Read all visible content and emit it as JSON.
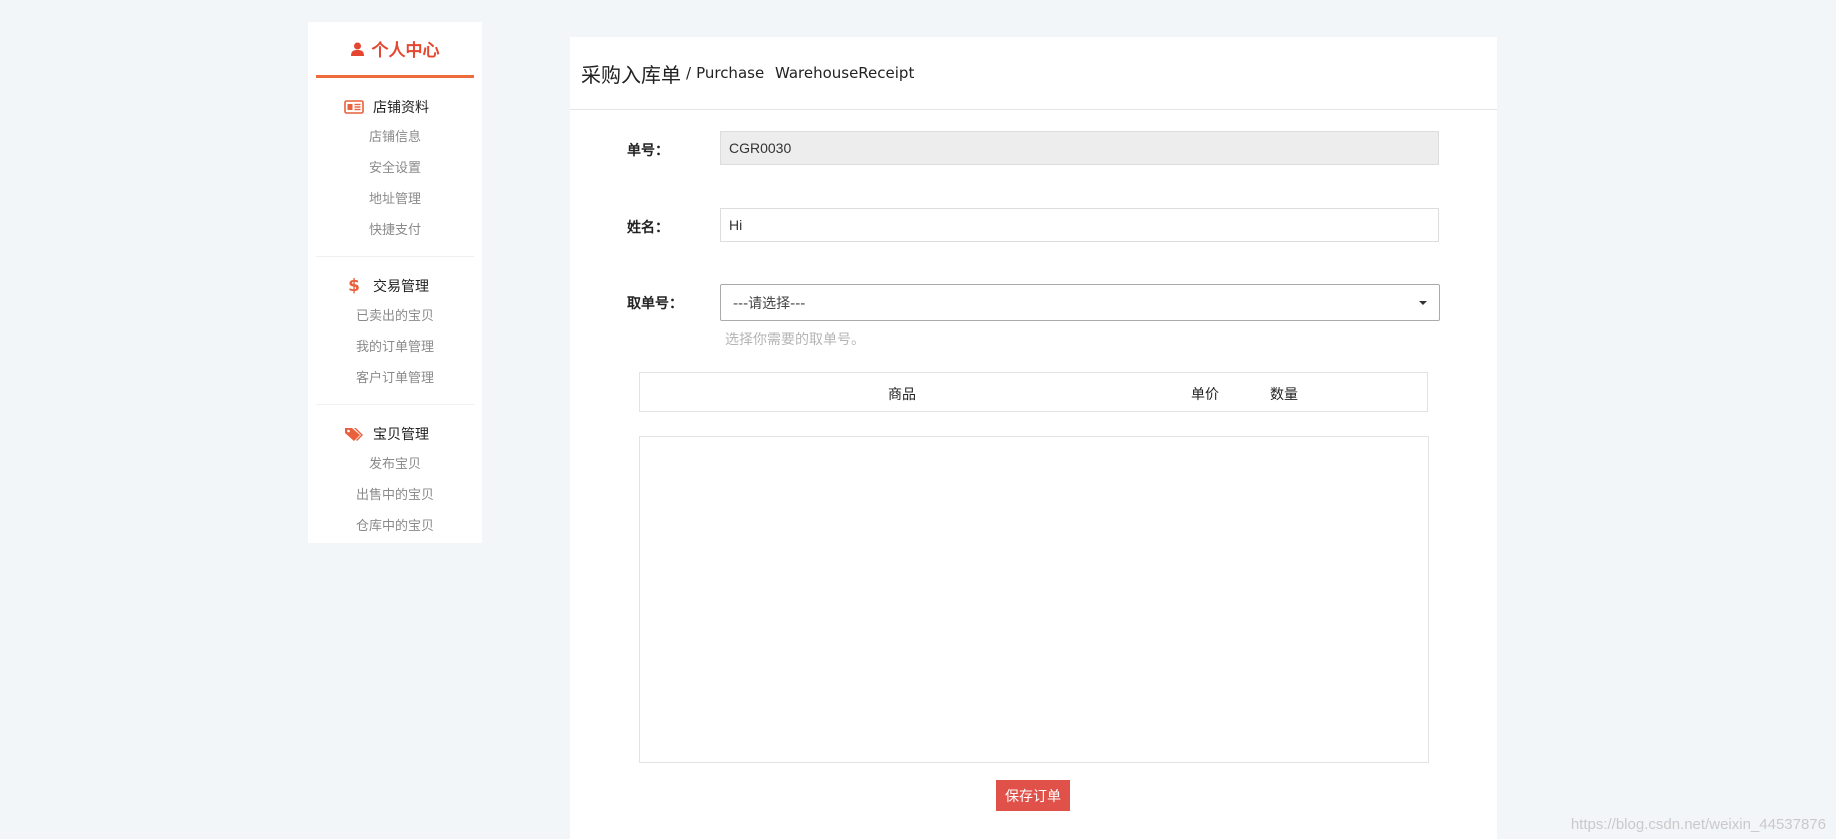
{
  "sidebar": {
    "header": {
      "label": "个人中心",
      "icon": "user-icon",
      "color": "#e5462f"
    },
    "groups": [
      {
        "title": "店铺资料",
        "icon": "id-card-icon",
        "items": [
          "店铺信息",
          "安全设置",
          "地址管理",
          "快捷支付"
        ]
      },
      {
        "title": "交易管理",
        "icon": "dollar-icon",
        "items": [
          "已卖出的宝贝",
          "我的订单管理",
          "客户订单管理"
        ]
      },
      {
        "title": "宝贝管理",
        "icon": "tags-icon",
        "items": [
          "发布宝贝",
          "出售中的宝贝",
          "仓库中的宝贝"
        ]
      }
    ]
  },
  "page": {
    "title_cn": "采购入库单",
    "title_sep": "/",
    "title_en": "Purchase  WarehouseReceipt"
  },
  "form": {
    "order_no": {
      "label": "单号：",
      "value": "CGR0030"
    },
    "name": {
      "label": "姓名：",
      "value": "Hi"
    },
    "pickup_no": {
      "label": "取单号：",
      "selected": "---请选择---",
      "help": "选择你需要的取单号。"
    }
  },
  "table": {
    "headers": {
      "product": "商品",
      "price": "单价",
      "quantity": "数量"
    },
    "rows": []
  },
  "actions": {
    "save_label": "保存订单"
  },
  "watermark": "https://blog.csdn.net/weixin_44537876",
  "colors": {
    "accent": "#ee6b3c",
    "button": "#e0514a",
    "background": "#f3f6f9"
  }
}
